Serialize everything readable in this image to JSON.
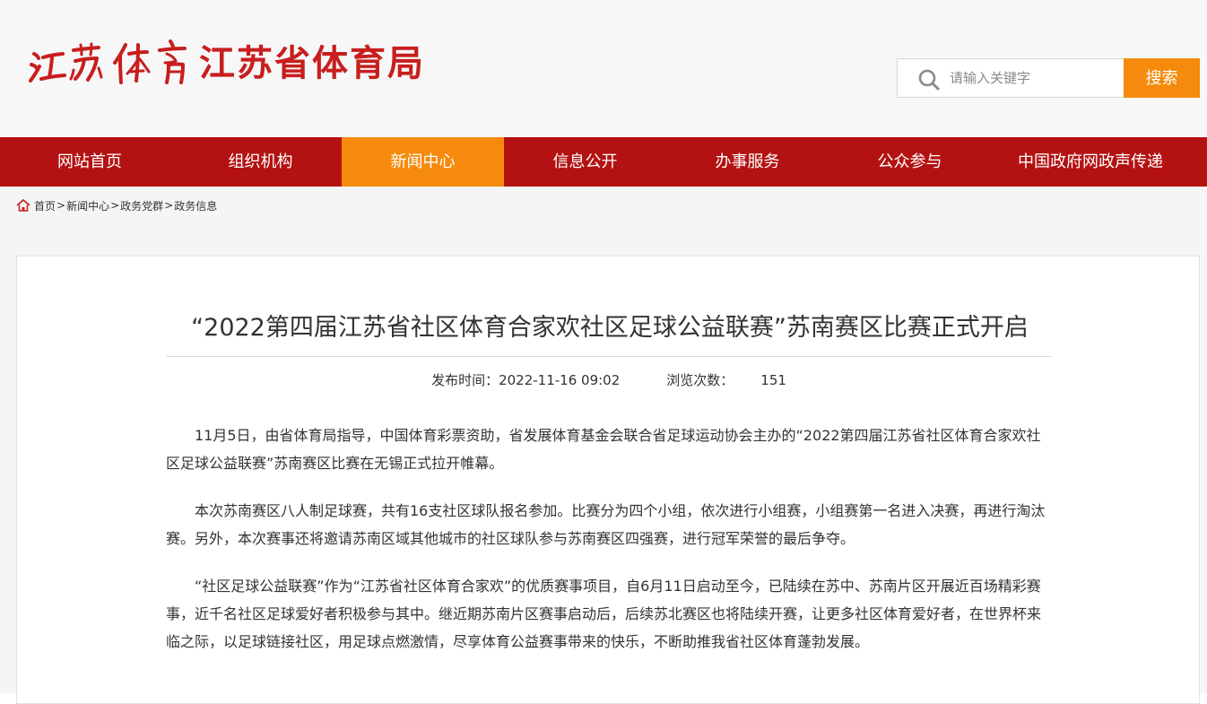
{
  "header": {
    "org_name": "江苏省体育局",
    "logo_calligraphy": "江苏体育",
    "search": {
      "placeholder": "请输入关键字",
      "button_label": "搜索"
    }
  },
  "nav": {
    "items": [
      {
        "label": "网站首页",
        "active": false
      },
      {
        "label": "组织机构",
        "active": false
      },
      {
        "label": "新闻中心",
        "active": true
      },
      {
        "label": "信息公开",
        "active": false
      },
      {
        "label": "办事服务",
        "active": false
      },
      {
        "label": "公众参与",
        "active": false
      },
      {
        "label": "中国政府网政声传递",
        "active": false
      }
    ]
  },
  "breadcrumb": {
    "items": [
      "首页",
      "新闻中心",
      "政务党群",
      "政务信息"
    ],
    "separator": ">"
  },
  "article": {
    "title": "“2022第四届江苏省社区体育合家欢社区足球公益联赛”苏南赛区比赛正式开启",
    "publish_label": "发布时间：",
    "publish_time": "2022-11-16 09:02",
    "views_label": "浏览次数：",
    "views_count": "151",
    "paragraphs": [
      "11月5日，由省体育局指导，中国体育彩票资助，省发展体育基金会联合省足球运动协会主办的“2022第四届江苏省社区体育合家欢社区足球公益联赛”苏南赛区比赛在无锡正式拉开帷幕。",
      "本次苏南赛区八人制足球赛，共有16支社区球队报名参加。比赛分为四个小组，依次进行小组赛，小组赛第一名进入决赛，再进行淘汰赛。另外，本次赛事还将邀请苏南区域其他城市的社区球队参与苏南赛区四强赛，进行冠军荣誉的最后争夺。",
      " “社区足球公益联赛”作为“江苏省社区体育合家欢”的优质赛事项目，自6月11日启动至今，已陆续在苏中、苏南片区开展近百场精彩赛事，近千名社区足球爱好者积极参与其中。继近期苏南片区赛事启动后，后续苏北赛区也将陆续开赛，让更多社区体育爱好者，在世界杯来临之际，以足球链接社区，用足球点燃激情，尽享体育公益赛事带来的快乐，不断助推我省社区体育蓬勃发展。"
    ]
  },
  "colors": {
    "brand_red": "#c81e1e",
    "nav_red": "#b41212",
    "accent_orange": "#f58a0c"
  }
}
